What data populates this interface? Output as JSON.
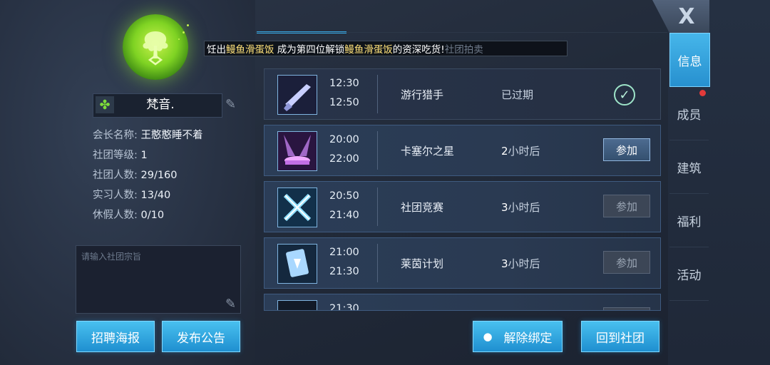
{
  "club": {
    "name": "梵音.",
    "leader_label": "会长名称:",
    "leader": "王憨憨睡不着",
    "level_label": "社团等级:",
    "level": "1",
    "members_label": "社团人数:",
    "members": "29/160",
    "interns_label": "实习人数:",
    "interns": "13/40",
    "vacation_label": "休假人数:",
    "vacation": "0/10",
    "motto_placeholder": "请输入社团宗旨"
  },
  "left_buttons": {
    "recruit": "招聘海报",
    "announce": "发布公告"
  },
  "ticker": {
    "p1": "饪出",
    "dish1": "鳗鱼滑蛋饭",
    "p2": "成为第四位解锁",
    "dish2": "鳗鱼滑蛋饭",
    "p3": "的资深吃货!",
    "faded": "社团拍卖"
  },
  "events": [
    {
      "start": "12:30",
      "end": "12:50",
      "name": "游行猎手",
      "status": "已过期",
      "action": "done",
      "icon": "shotgun-icon"
    },
    {
      "start": "20:00",
      "end": "22:00",
      "name": "卡塞尔之星",
      "status_num": "2",
      "status_unit": "小时后",
      "action": "参加",
      "icon": "stage-icon"
    },
    {
      "start": "20:50",
      "end": "21:40",
      "name": "社团竞赛",
      "status_num": "3",
      "status_unit": "小时后",
      "action": "参加",
      "icon": "crossed-swords-icon"
    },
    {
      "start": "21:00",
      "end": "21:30",
      "name": "莱茵计划",
      "status_num": "3",
      "status_unit": "小时后",
      "action": "参加",
      "icon": "card-icon"
    },
    {
      "start": "21:30"
    }
  ],
  "bottom_buttons": {
    "unbind": "解除绑定",
    "back": "回到社团"
  },
  "tabs": [
    "信息",
    "成员",
    "建筑",
    "福利",
    "活动"
  ],
  "close_label": "X",
  "colors": {
    "accent": "#37a8e4",
    "highlight": "#ffe27a",
    "notify": "#e23a3a"
  }
}
